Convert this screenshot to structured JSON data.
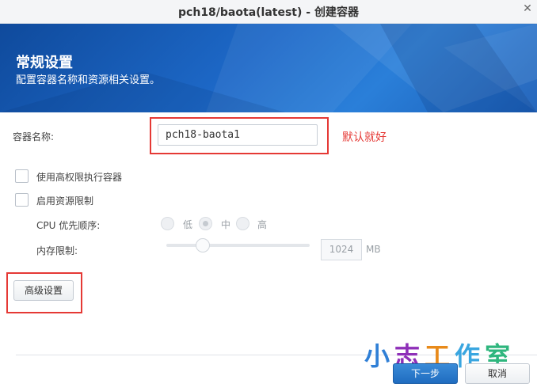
{
  "window": {
    "title": "pch18/baota(latest) - 创建容器",
    "close_glyph": "✕"
  },
  "banner": {
    "heading": "常规设置",
    "subheading": "配置容器名称和资源相关设置。"
  },
  "form": {
    "container_name_label": "容器名称:",
    "container_name_value": "pch18-baota1",
    "annotation": "默认就好",
    "privileged_label": "使用高权限执行容器",
    "privileged_checked": false,
    "resource_limit_label": "启用资源限制",
    "resource_limit_checked": false,
    "cpu_priority_label": "CPU 优先顺序:",
    "cpu_options": [
      {
        "label": "低",
        "selected": false
      },
      {
        "label": "中",
        "selected": true
      },
      {
        "label": "高",
        "selected": false
      }
    ],
    "memory_limit_label": "内存限制:",
    "memory_value": "1024",
    "memory_unit": "MB",
    "memory_slider_fraction": 0.2
  },
  "buttons": {
    "advanced": "高级设置",
    "next": "下一步",
    "cancel": "取消"
  },
  "watermark": {
    "chars": [
      "小",
      "志",
      "工",
      "作",
      "室"
    ]
  },
  "colors": {
    "accent": "#1f6cc0",
    "highlight": "#e53935",
    "banner": "#1d68c7"
  }
}
